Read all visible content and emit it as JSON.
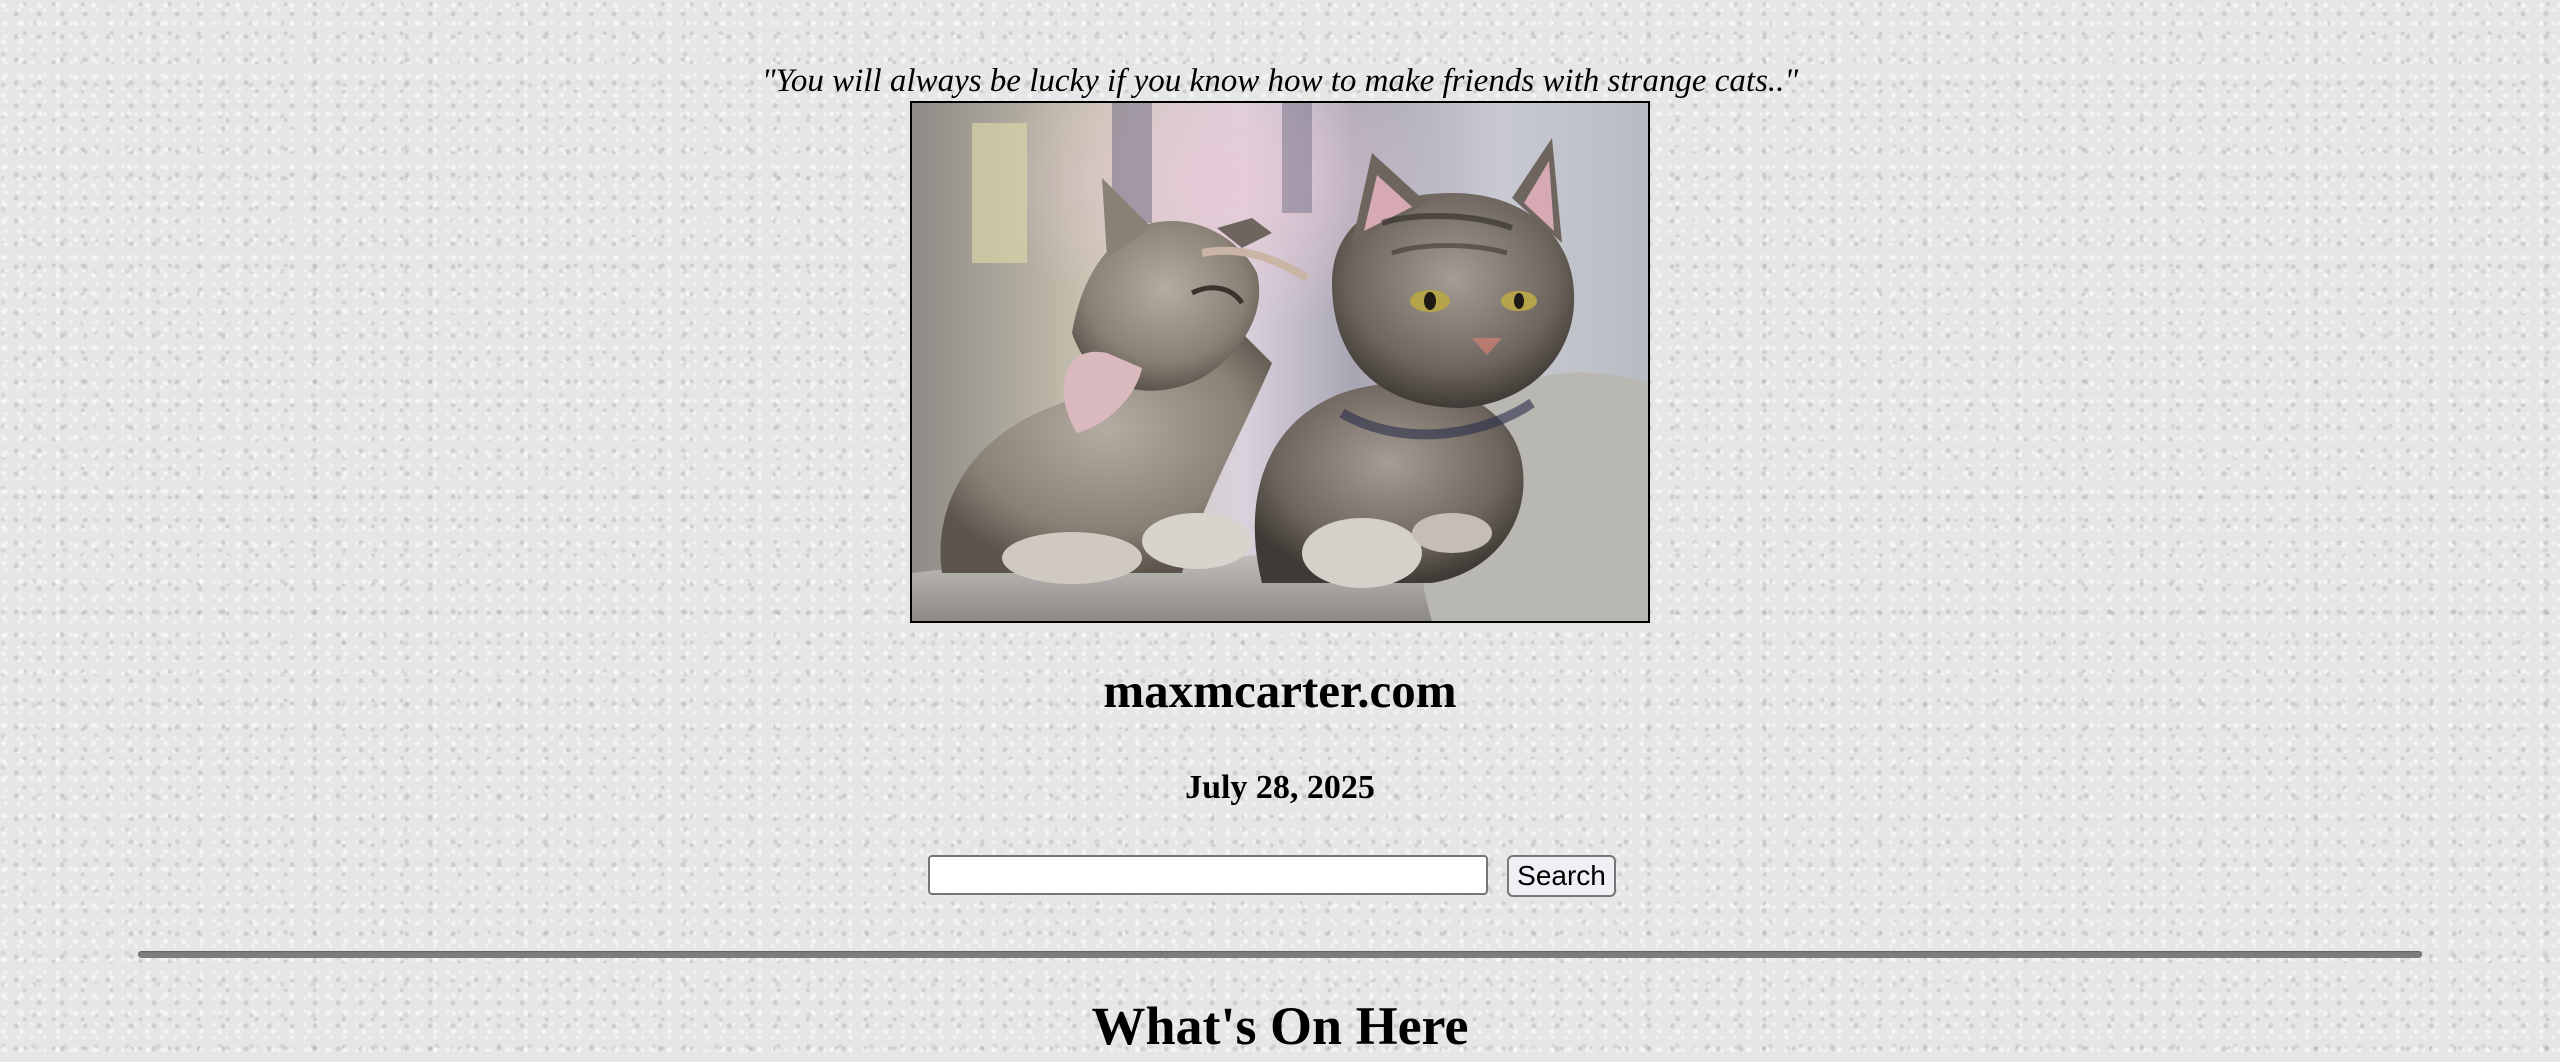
{
  "quote": "\"You will always be lucky if you know how to make friends with strange cats..\"",
  "photo": {
    "subject": "two tabby kittens, one nuzzling the other"
  },
  "site_title": "maxmcarter.com",
  "date": "July 28, 2025",
  "search": {
    "value": "",
    "placeholder": "",
    "button_label": "Search"
  },
  "section_heading": "What's On Here"
}
